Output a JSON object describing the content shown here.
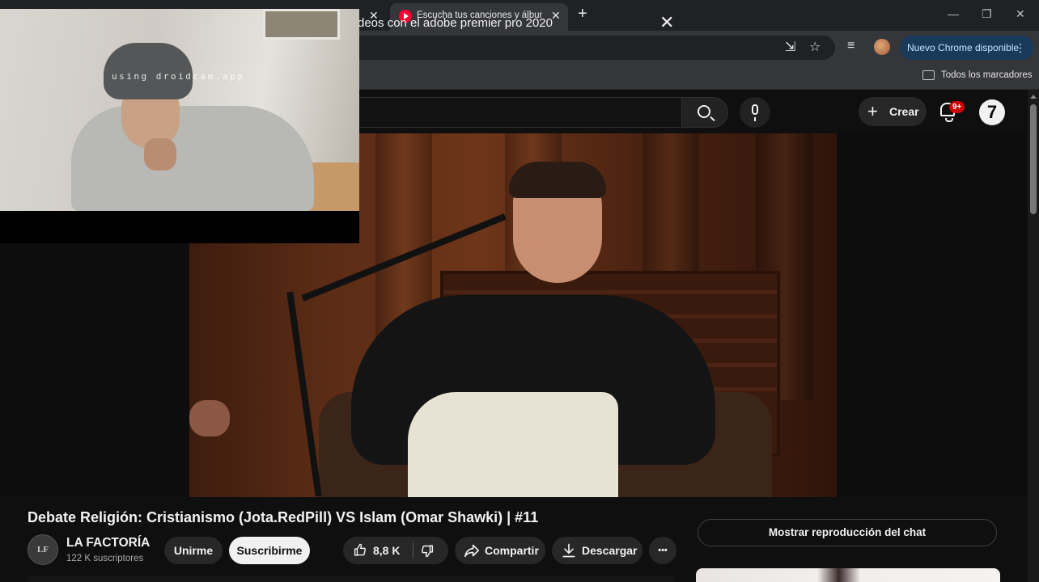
{
  "browser": {
    "tab_title": "Escucha tus canciones y álbumes",
    "update_button": "Nuevo Chrome disponible",
    "bookmarks_all": "Todos los marcadores",
    "colors": {
      "frame": "#202124",
      "toolbar": "#35363a",
      "update_bg": "#1a3a5c"
    }
  },
  "webcam": {
    "watermark": "using droidcam.app"
  },
  "youtube": {
    "search_query": "deos con el adobe premier pro 2020",
    "create_label": "Crear",
    "notifications_badge": "9+",
    "account_initial": "7"
  },
  "video": {
    "title": "Debate Religión: Cristianismo (Jota.RedPill) VS Islam (Omar Shawki) | #11",
    "channel": {
      "name": "LA FACTORÍA",
      "subscribers": "122 K suscriptores",
      "avatar_text": "LF"
    },
    "actions": {
      "join": "Unirme",
      "subscribe": "Suscribirme",
      "likes": "8,8 K",
      "share": "Compartir",
      "download": "Descargar",
      "more": "•••"
    },
    "chat_replay": "Mostrar reproducción del chat"
  }
}
